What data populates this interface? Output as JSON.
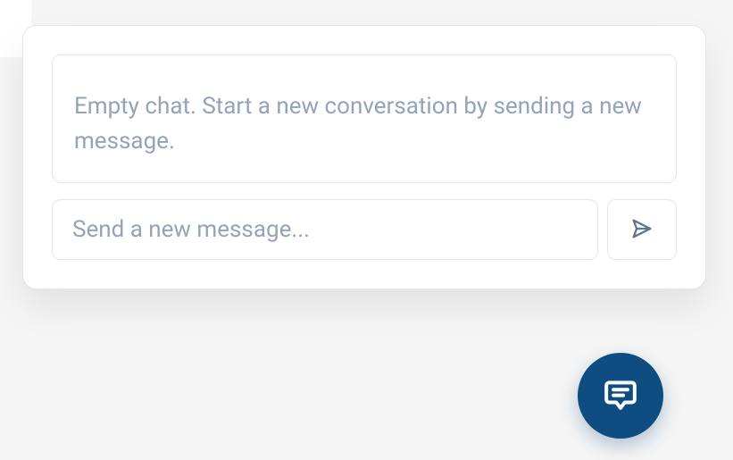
{
  "chat": {
    "empty_state_text": "Empty chat. Start a new conversation by sending a new message.",
    "input": {
      "placeholder": "Send a new message...",
      "value": ""
    },
    "send_button_label": "Send",
    "fab_label": "Open chat"
  }
}
